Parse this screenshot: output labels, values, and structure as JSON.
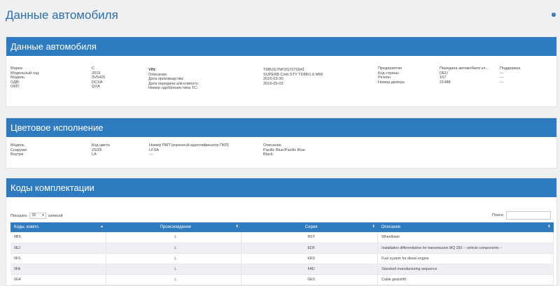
{
  "page": {
    "title": "Данные автомобиля"
  },
  "car": {
    "header": "Данные автомобиля",
    "col1_labels": [
      "Марка:",
      "Модельный год:",
      "Модель:",
      "ОДВ:",
      "ОКП:"
    ],
    "col1_values": [
      "C",
      "2016",
      "3V5425",
      "DCXA",
      "QXA"
    ],
    "col2_labels": [
      "VIN:",
      "Описание:",
      "Дата производства:",
      "Дата передачи а/м клиенту:",
      "Номер одобрения типа ТС:"
    ],
    "col2_values": [
      "TMBJG7NP2G7070941",
      "SUPERB Cmb STY TD88/1.6 M6F",
      "2016-03-30",
      "2016-05-03",
      ""
    ],
    "col3_labels": [
      "Предприятие",
      "Код страны",
      "Регион",
      "Номер дилера"
    ],
    "col3_values": [
      "Передача автомобиля кл...",
      "DEU",
      "107",
      "21488"
    ],
    "col4_values": [
      "Поддержка",
      "---",
      "---",
      "---"
    ]
  },
  "color": {
    "header": "Цветовое исполнение",
    "col1": [
      "Модель",
      "Снаружи",
      "Внутри"
    ],
    "col2": [
      "Код цвета",
      "Z5/Z5",
      "LA"
    ],
    "col3": [
      "Номер ПКП (коренной идентификатор ПКП)",
      "LFSA",
      "---"
    ],
    "col4": [
      "Описание",
      "Pacific Blue/Pacific Blue",
      "Black"
    ]
  },
  "codes": {
    "header": "Коды комплектации",
    "show_label": "Показать",
    "page_size": "50",
    "entries_label": "записей",
    "search_label": "Поиск:",
    "columns": [
      "Коды. компл.",
      "Происхождение",
      "Серия",
      "Описание"
    ],
    "rows": [
      [
        "0BS",
        "L",
        "RST",
        "Wheelbase"
      ],
      [
        "0EJ",
        "L",
        "EDF",
        "Installation differentiation for transmission MQ 250 -- vehicle components --"
      ],
      [
        "0FS",
        "L",
        "KRS",
        "Fuel system for diesel engine"
      ],
      [
        "0FA",
        "L",
        "FAD",
        "Standard manufacturing sequence"
      ],
      [
        "0G4",
        "L",
        "GES",
        "Cable gearshift"
      ]
    ]
  }
}
